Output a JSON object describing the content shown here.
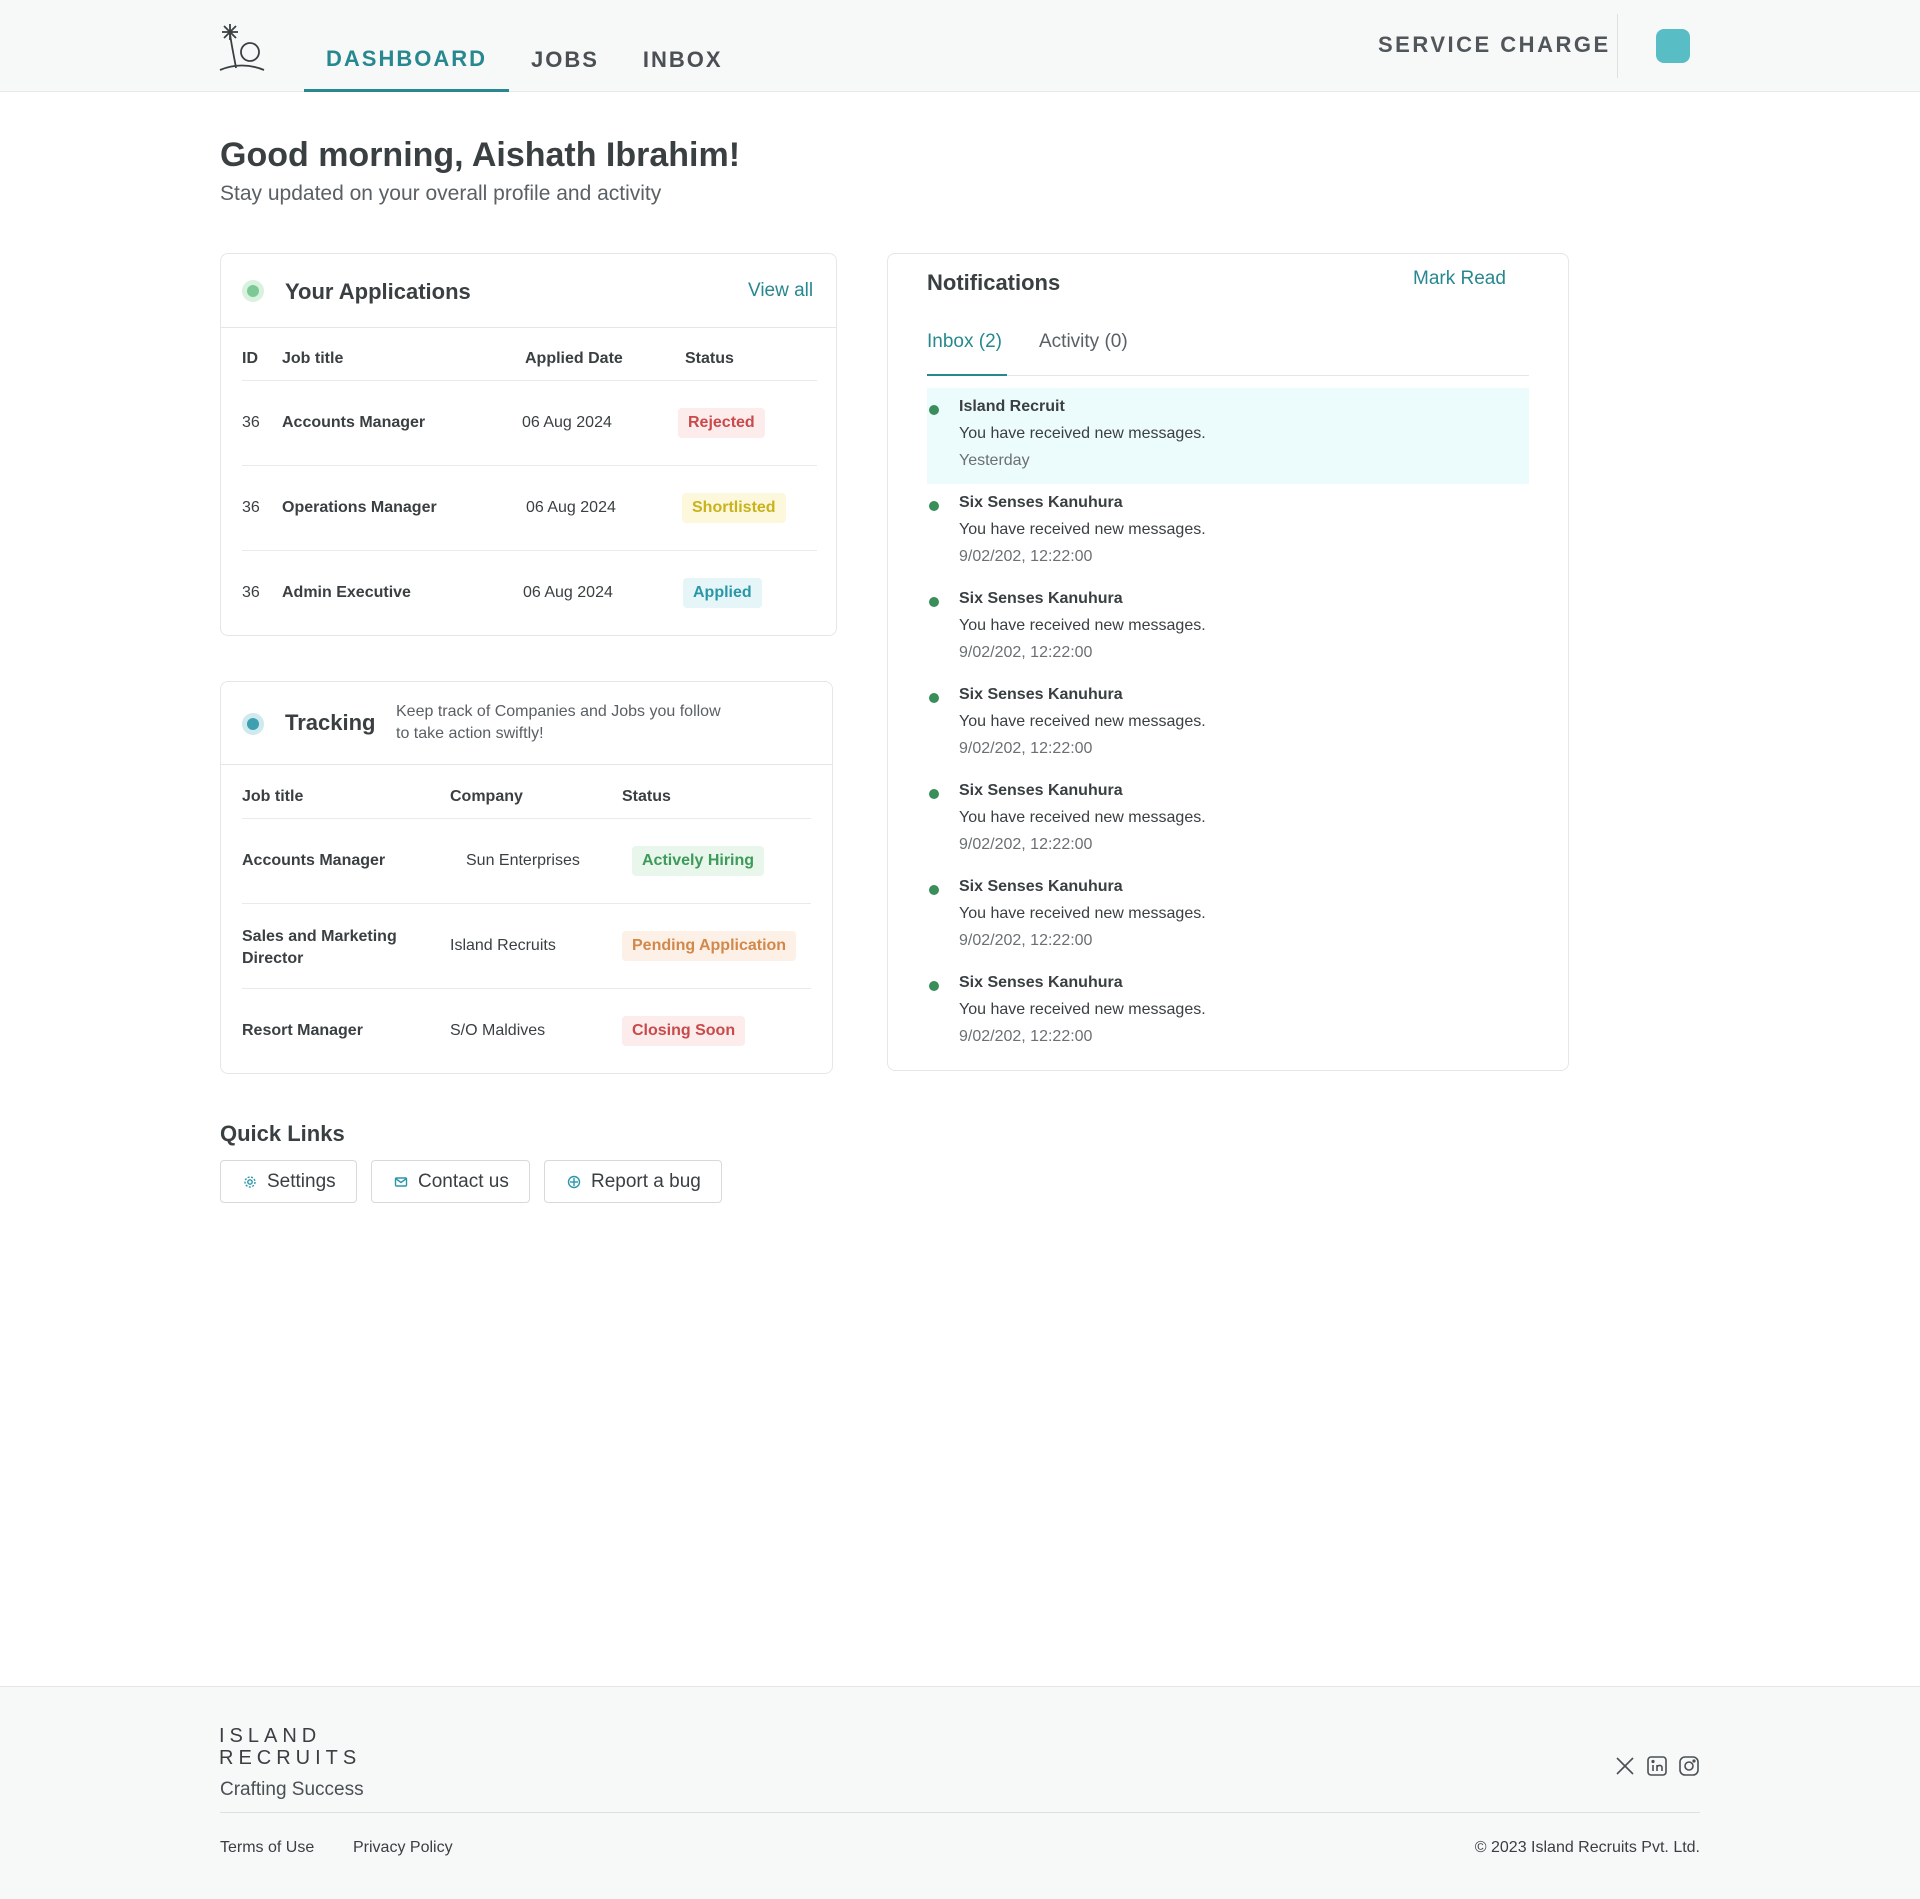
{
  "header": {
    "nav": [
      {
        "label": "DASHBOARD",
        "active": true
      },
      {
        "label": "JOBS",
        "active": false
      },
      {
        "label": "INBOX",
        "active": false
      }
    ],
    "service_charge": "SERVICE CHARGE",
    "icons": {
      "logo": "palm-sun-logo-icon",
      "avatar": "user-avatar"
    },
    "accent_color": "#27888f"
  },
  "greeting": {
    "title": "Good morning, Aishath Ibrahim!",
    "subtitle": "Stay updated on your overall profile and activity"
  },
  "applications": {
    "title": "Your Applications",
    "view_all": "View all",
    "columns": [
      "ID",
      "Job title",
      "Applied Date",
      "Status"
    ],
    "rows": [
      {
        "id": "36",
        "job": "Accounts Manager",
        "date": "06 Aug 2024",
        "status": "Rejected"
      },
      {
        "id": "36",
        "job": "Operations Manager",
        "date": "06 Aug 2024",
        "status": "Shortlisted"
      },
      {
        "id": "36",
        "job": "Admin Executive",
        "date": "06 Aug 2024",
        "status": "Applied"
      }
    ]
  },
  "tracking": {
    "title": "Tracking",
    "description_line1": "Keep track of Companies and Jobs you follow",
    "description_line2": "to take action swiftly!",
    "columns": [
      "Job title",
      "Company",
      "Status"
    ],
    "rows": [
      {
        "job_line1": "Accounts Manager",
        "job_line2": "",
        "company": "Sun Enterprises",
        "status": "Actively Hiring"
      },
      {
        "job_line1": "Sales and Marketing",
        "job_line2": "Director",
        "company": "Island Recruits",
        "status": "Pending Application"
      },
      {
        "job_line1": "Resort Manager",
        "job_line2": "",
        "company": "S/O Maldives",
        "status": "Closing Soon"
      }
    ]
  },
  "notifications": {
    "title": "Notifications",
    "mark_read": "Mark Read",
    "tabs": [
      {
        "label": "Inbox (2)",
        "active": true
      },
      {
        "label": "Activity (0)",
        "active": false
      }
    ],
    "items": [
      {
        "sender": "Island Recruit",
        "message": "You have received new messages.",
        "time": "Yesterday"
      },
      {
        "sender": "Six Senses Kanuhura",
        "message": "You have received new messages.",
        "time": "9/02/202, 12:22:00"
      },
      {
        "sender": "Six Senses Kanuhura",
        "message": "You have received new messages.",
        "time": "9/02/202, 12:22:00"
      },
      {
        "sender": "Six Senses Kanuhura",
        "message": "You have received new messages.",
        "time": "9/02/202, 12:22:00"
      },
      {
        "sender": "Six Senses Kanuhura",
        "message": "You have received new messages.",
        "time": "9/02/202, 12:22:00"
      },
      {
        "sender": "Six Senses Kanuhura",
        "message": "You have received new messages.",
        "time": "9/02/202, 12:22:00"
      },
      {
        "sender": "Six Senses Kanuhura",
        "message": "You have received new messages.",
        "time": "9/02/202, 12:22:00"
      }
    ]
  },
  "quick_links": {
    "title": "Quick Links",
    "items": [
      {
        "label": "Settings",
        "icon": "gear-icon"
      },
      {
        "label": "Contact us",
        "icon": "mail-icon"
      },
      {
        "label": "Report a bug",
        "icon": "bug-icon"
      }
    ]
  },
  "footer": {
    "brand_line1": "ISLAND",
    "brand_line2": "RECRUITS",
    "tagline": "Crafting Success",
    "links": [
      "Terms of Use",
      "Privacy Policy"
    ],
    "copyright": "© 2023 Island Recruits Pvt. Ltd.",
    "social_icons": [
      "x-icon",
      "linkedin-icon",
      "instagram-icon"
    ]
  }
}
